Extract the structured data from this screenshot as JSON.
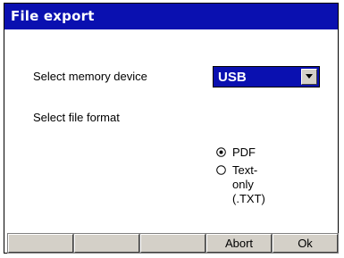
{
  "window": {
    "title": "File export"
  },
  "form": {
    "memory_device_label": "Select memory device",
    "memory_device_value": "USB",
    "file_format_label": "Select file format",
    "file_format_options": [
      {
        "label": "PDF",
        "selected": true
      },
      {
        "label": "Text-only (.TXT)",
        "selected": false
      }
    ]
  },
  "footer": {
    "buttons": [
      "",
      "",
      "",
      "Abort",
      "Ok"
    ]
  },
  "colors": {
    "title_bar": "#0a10b0",
    "dropdown_bg": "#0a10b0",
    "button_face": "#d4d0c8"
  }
}
